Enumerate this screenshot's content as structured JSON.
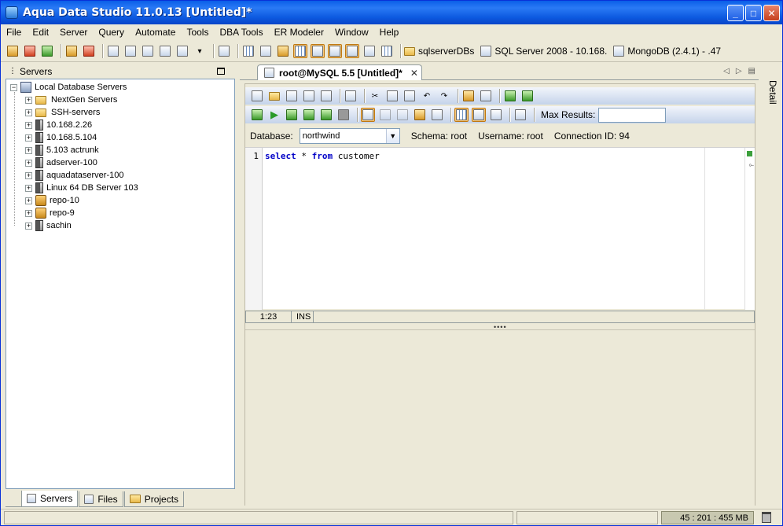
{
  "window": {
    "title": "Aqua Data Studio 11.0.13 [Untitled]*"
  },
  "menu": [
    "File",
    "Edit",
    "Server",
    "Query",
    "Automate",
    "Tools",
    "DBA Tools",
    "ER Modeler",
    "Window",
    "Help"
  ],
  "toolbar": {
    "connections": [
      {
        "label": "sqlserverDBs",
        "icon": "folder-icon"
      },
      {
        "label": "SQL Server 2008 - 10.168.",
        "icon": "server-icon"
      },
      {
        "label": "MongoDB (2.4.1) - .47",
        "icon": "server-icon"
      }
    ]
  },
  "servers_panel": {
    "title": "Servers",
    "root": "Local Database Servers",
    "items": [
      {
        "label": "NextGen Servers",
        "type": "folder"
      },
      {
        "label": "SSH-servers",
        "type": "folder"
      },
      {
        "label": "10.168.2.26",
        "type": "server"
      },
      {
        "label": "10.168.5.104",
        "type": "server"
      },
      {
        "label": "5.103 actrunk",
        "type": "server"
      },
      {
        "label": "adserver-100",
        "type": "server"
      },
      {
        "label": "aquadataserver-100",
        "type": "server"
      },
      {
        "label": "Linux 64 DB Server 103",
        "type": "server"
      },
      {
        "label": "repo-10",
        "type": "repo"
      },
      {
        "label": "repo-9",
        "type": "repo"
      },
      {
        "label": "sachin",
        "type": "server"
      }
    ],
    "tabs": [
      "Servers",
      "Files",
      "Projects"
    ]
  },
  "editor": {
    "tab_title": "root@MySQL 5.5 [Untitled]*",
    "max_results_label": "Max Results:",
    "database_label": "Database:",
    "database_value": "northwind",
    "schema_label": "Schema:",
    "schema_value": "root",
    "username_label": "Username:",
    "username_value": "root",
    "connection_label": "Connection ID:",
    "connection_value": "94",
    "line_number": "1",
    "code": {
      "kw1": "select",
      "mid": " * ",
      "kw2": "from",
      "rest": " customer"
    },
    "cursor_pos": "1:23",
    "mode": "INS"
  },
  "detail_label": "Detail",
  "status": {
    "memory": "45 : 201 : 455 MB"
  }
}
